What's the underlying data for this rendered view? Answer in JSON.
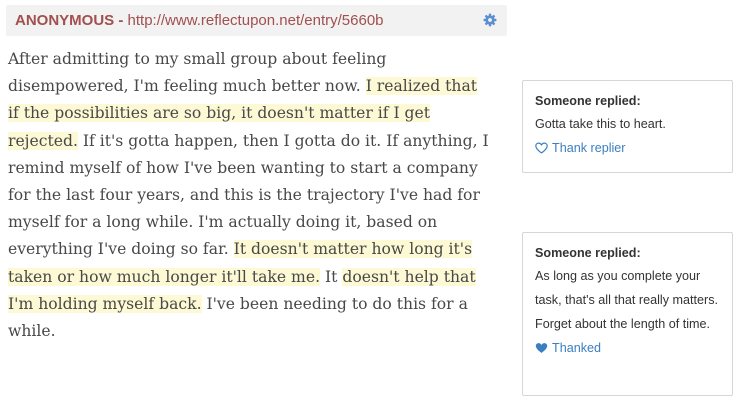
{
  "entry": {
    "author": "ANONYMOUS",
    "separator": " - ",
    "url": "http://www.reflectupon.net/entry/5660b",
    "segments": [
      {
        "text": "After admitting to my small group about feeling disempowered, I'm feeling much better now. ",
        "highlight": false
      },
      {
        "text": "I realized that if the possibilities are so big, it doesn't matter if I get rejected.",
        "highlight": true
      },
      {
        "text": " If it's gotta happen, then I gotta do it. If anything, I remind myself of how I've been wanting to start a company for the last four years, and this is the trajectory I've had for myself for a long while. I'm actually doing it, based on everything I've doing so far. ",
        "highlight": false
      },
      {
        "text": "It doesn't matter how long it's taken or how much longer it'll take me.",
        "highlight": true
      },
      {
        "text": " It ",
        "highlight": false
      },
      {
        "text": "doesn't help that I'm holding myself back.",
        "highlight": true
      },
      {
        "text": " I've been needing to do this for a while.",
        "highlight": false
      }
    ]
  },
  "replies": [
    {
      "title": "Someone replied:",
      "text": "Gotta take this to heart.",
      "action": "Thank replier",
      "thanked": false
    },
    {
      "title": "Someone replied:",
      "text": "As long as you complete your task, that's all that really matters. Forget about the length of time.",
      "action": "Thanked",
      "thanked": true
    }
  ],
  "icons": {
    "settings": "gear-icon",
    "thank": "heart-outline-icon",
    "thanked": "heart-filled-icon"
  },
  "colors": {
    "author": "#a14f4f",
    "highlight": "#fcf9d4",
    "link": "#3a7fc1",
    "gear": "#5b8fd0"
  }
}
